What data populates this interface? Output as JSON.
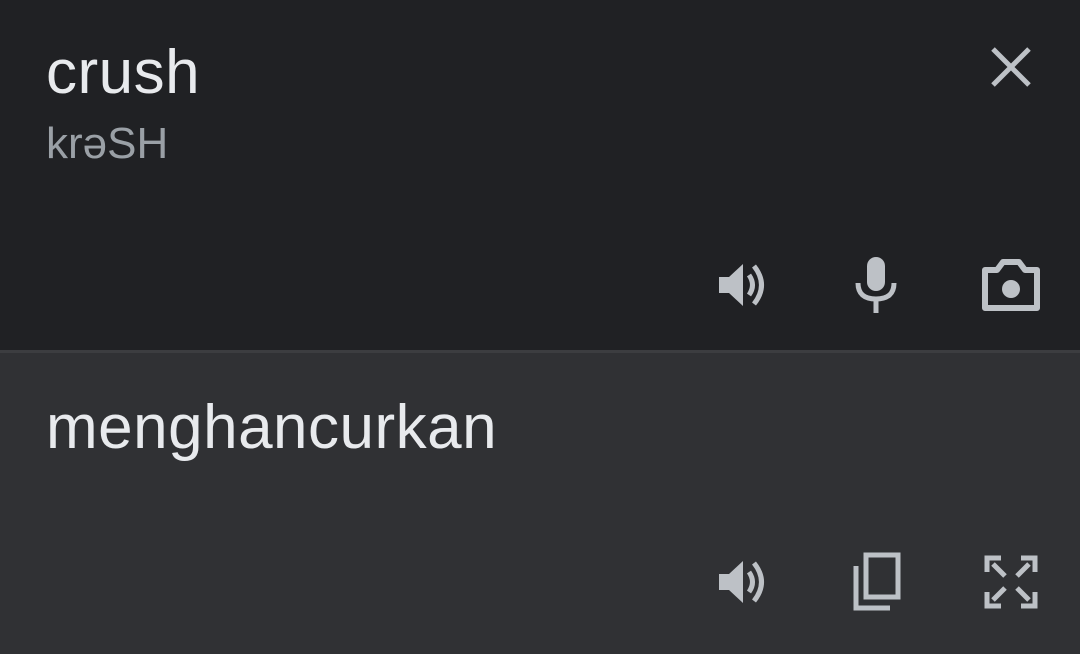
{
  "source": {
    "text": "crush",
    "phonetic": "krəSH",
    "icons": {
      "close": "close-icon",
      "speaker": "speaker-icon",
      "mic": "microphone-icon",
      "camera": "camera-icon"
    }
  },
  "translation": {
    "text": "menghancurkan",
    "icons": {
      "speaker": "speaker-icon",
      "copy": "copy-icon",
      "fullscreen": "fullscreen-icon"
    }
  },
  "colors": {
    "source_bg": "#202124",
    "target_bg": "#303134",
    "primary_text": "#e8eaed",
    "secondary_text": "#9aa0a6",
    "icon": "#bdc1c6"
  }
}
